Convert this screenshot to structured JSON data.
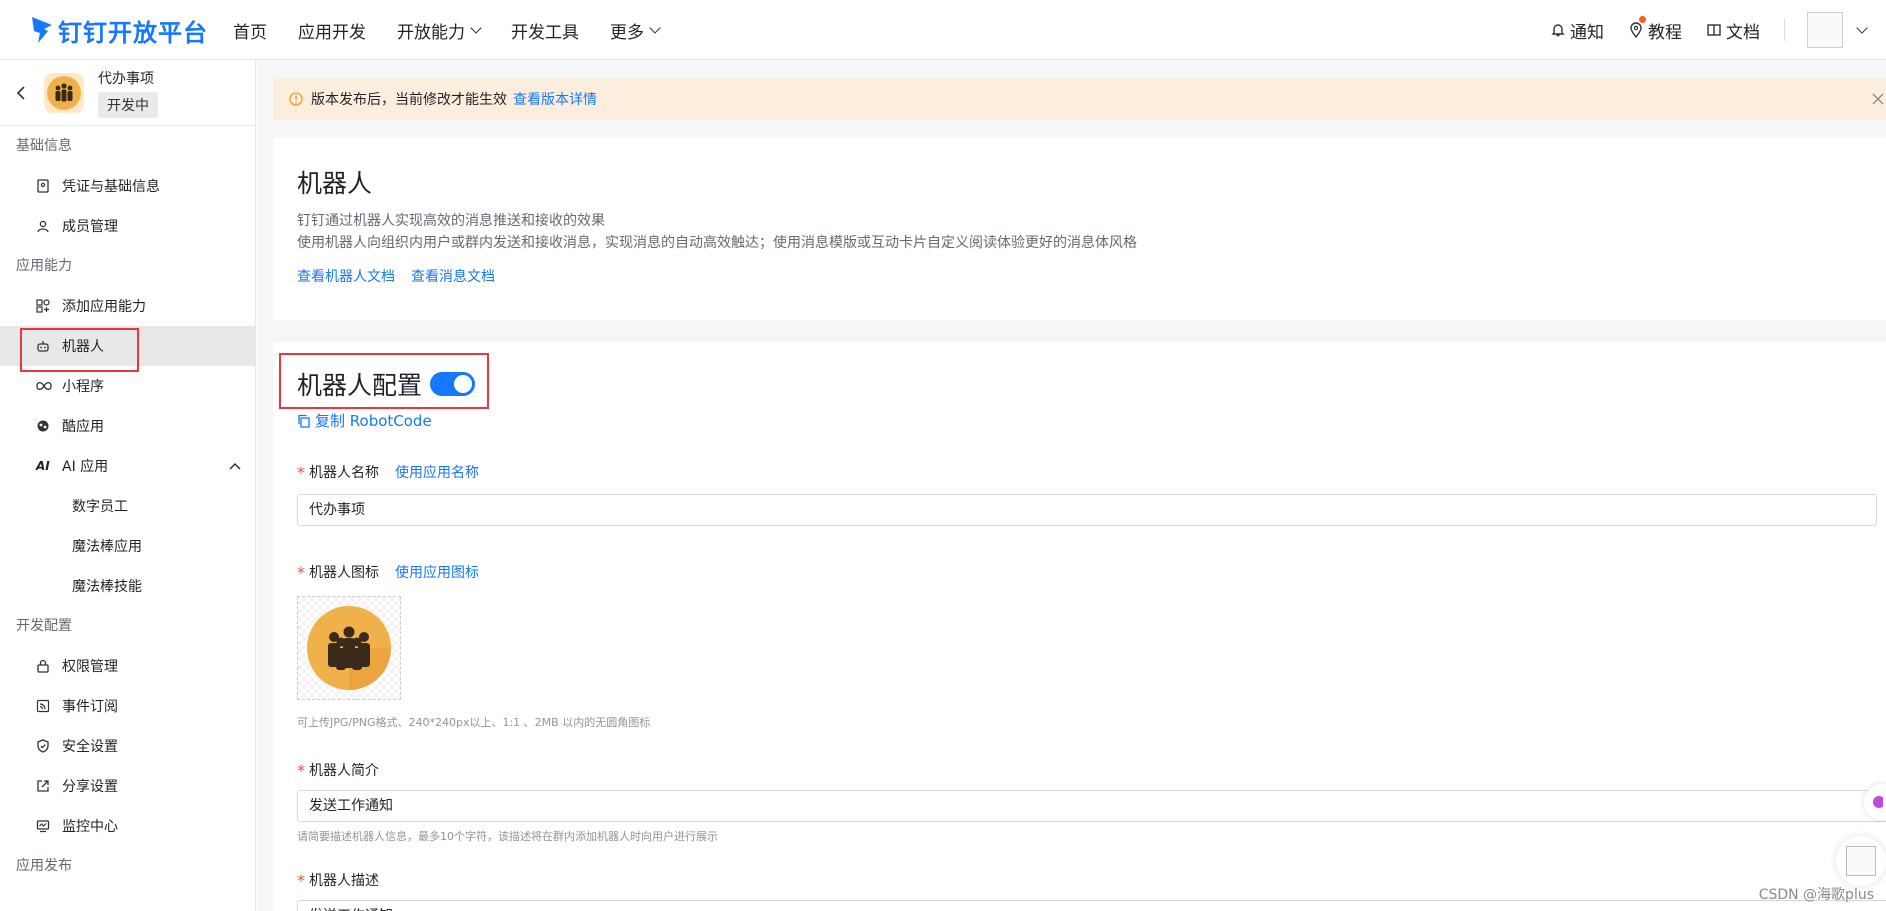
{
  "header": {
    "logo_text": "钉钉开放平台",
    "nav": [
      {
        "label": "首页",
        "dropdown": false
      },
      {
        "label": "应用开发",
        "dropdown": false
      },
      {
        "label": "开放能力",
        "dropdown": true
      },
      {
        "label": "开发工具",
        "dropdown": false
      },
      {
        "label": "更多",
        "dropdown": true
      }
    ],
    "notify_label": "通知",
    "tutorial_label": "教程",
    "docs_label": "文档"
  },
  "sidebar": {
    "app_name": "代办事项",
    "app_status": "开发中",
    "sections": {
      "basic": "基础信息",
      "ability": "应用能力",
      "dev_config": "开发配置",
      "release": "应用发布"
    },
    "items": {
      "credentials": "凭证与基础信息",
      "members": "成员管理",
      "add_ability": "添加应用能力",
      "robot": "机器人",
      "mini_program": "小程序",
      "cool_app": "酷应用",
      "ai_app": "AI 应用",
      "digital_employee": "数字员工",
      "magic_app": "魔法棒应用",
      "magic_skill": "魔法棒技能",
      "permissions": "权限管理",
      "events": "事件订阅",
      "security": "安全设置",
      "share": "分享设置",
      "monitor": "监控中心"
    }
  },
  "alert": {
    "text": "版本发布后，当前修改才能生效",
    "link": "查看版本详情"
  },
  "intro": {
    "title": "机器人",
    "line1": "钉钉通过机器人实现高效的消息推送和接收的效果",
    "line2": "使用机器人向组织内用户或群内发送和接收消息，实现消息的自动高效触达；使用消息模版或互动卡片自定义阅读体验更好的消息体风格",
    "doc_link1": "查看机器人文档",
    "doc_link2": "查看消息文档"
  },
  "config": {
    "title": "机器人配置",
    "enabled": true,
    "copy_label": "复制 RobotCode",
    "name_label": "机器人名称",
    "name_action": "使用应用名称",
    "name_value": "代办事项",
    "icon_label": "机器人图标",
    "icon_action": "使用应用图标",
    "icon_hint": "可上传JPG/PNG格式、240*240px以上、1:1 、2MB 以内的无圆角图标",
    "brief_label": "机器人简介",
    "brief_value": "发送工作通知",
    "brief_hint": "请简要描述机器人信息，最多10个字符，该描述将在群内添加机器人时向用户进行展示",
    "desc_label": "机器人描述",
    "desc_value": "发送工作通知"
  },
  "watermark": "CSDN @海歌plus",
  "colors": {
    "brand": "#1677ff",
    "alert_bg": "#fbeedd",
    "highlight_border": "#e8383d",
    "required": "#f54a45"
  }
}
